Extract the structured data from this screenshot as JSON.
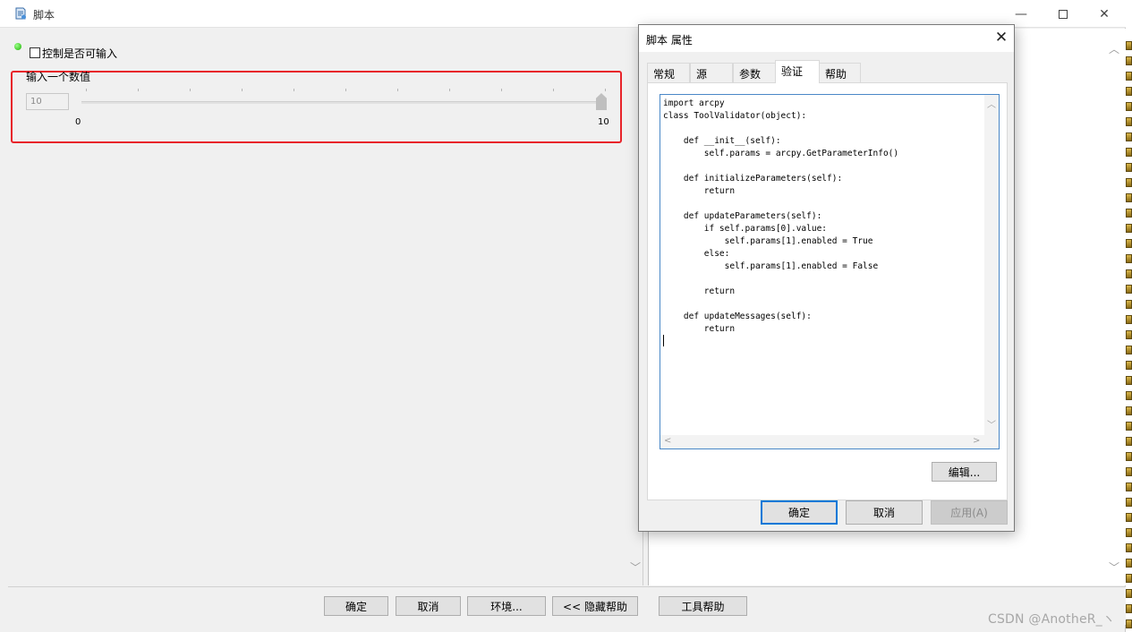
{
  "main_window": {
    "title": "脚本",
    "controls": {
      "minimize": "—",
      "close": "✕"
    }
  },
  "tool_form": {
    "checkbox": {
      "label": "控制是否可输入",
      "checked": false
    },
    "parameter": {
      "label": "输入一个数值",
      "value": "10",
      "slider": {
        "min": "0",
        "max": "10",
        "current": 10
      }
    }
  },
  "bottom_buttons": {
    "ok": "确定",
    "cancel": "取消",
    "environments": "环境...",
    "hide_help": "<< 隐藏帮助",
    "tool_help": "工具帮助"
  },
  "dialog": {
    "title": "脚本 属性",
    "close": "✕",
    "tabs": [
      {
        "label": "常规",
        "active": false
      },
      {
        "label": "源",
        "active": false
      },
      {
        "label": "参数",
        "active": false
      },
      {
        "label": "验证",
        "active": true
      },
      {
        "label": "帮助",
        "active": false
      }
    ],
    "code": "import arcpy\nclass ToolValidator(object):\n\n    def __init__(self):\n        self.params = arcpy.GetParameterInfo()\n\n    def initializeParameters(self):\n        return\n\n    def updateParameters(self):\n        if self.params[0].value:\n            self.params[1].enabled = True\n        else:\n            self.params[1].enabled = False\n\n        return\n\n    def updateMessages(self):\n        return",
    "edit_button": "编辑...",
    "ok_button": "确定",
    "cancel_button": "取消",
    "apply_button": "应用(A)"
  },
  "watermark": "CSDN @AnotheR_ヽ",
  "colors": {
    "highlight": "#e8232a",
    "focus": "#0078d7"
  }
}
